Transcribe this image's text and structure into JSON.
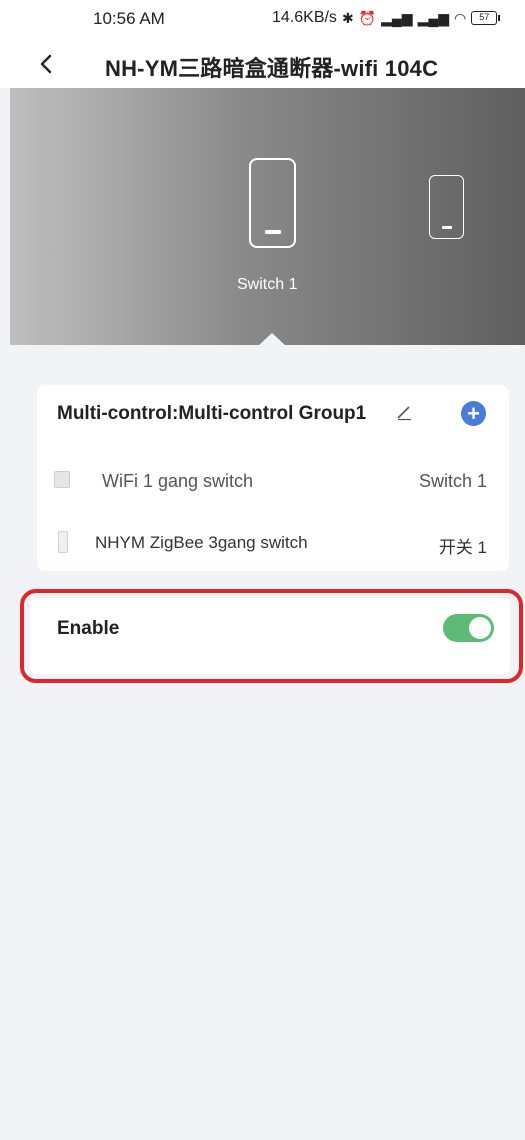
{
  "status_bar": {
    "time": "10:56 AM",
    "net_speed": "14.6KB/s",
    "battery": "57",
    "icons": [
      "bluetooth-icon",
      "alarm-icon",
      "signal-icon",
      "signal-icon",
      "wifi-icon",
      "battery-icon"
    ]
  },
  "header": {
    "title": "NH-YM三路暗盒通断器-wifi 104C"
  },
  "hero": {
    "switches": [
      "switch-1",
      "switch-2"
    ],
    "selected_label": "Switch 1"
  },
  "group": {
    "title": "Multi-control:Multi-control  Group1",
    "devices": [
      {
        "name": "WiFi 1 gang switch",
        "channel": "Switch 1"
      },
      {
        "name": "NHYM ZigBee 3gang switch",
        "channel": "开关 1"
      }
    ]
  },
  "enable": {
    "label": "Enable",
    "state": "on"
  },
  "colors": {
    "accent_blue": "#4a7bd8",
    "toggle_green": "#5dbb76",
    "highlight_red": "#e0262a"
  }
}
